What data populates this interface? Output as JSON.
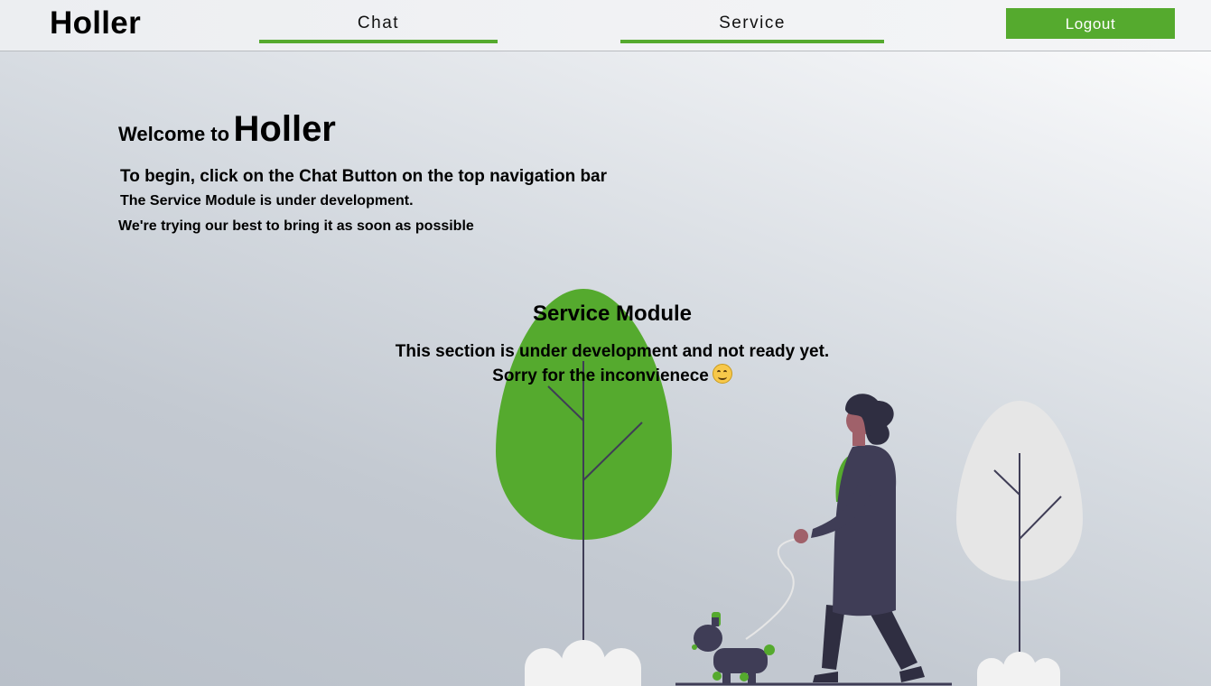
{
  "nav": {
    "brand": "Holler",
    "tabs": [
      {
        "label": "Chat"
      },
      {
        "label": "Service"
      }
    ],
    "logout_label": "Logout"
  },
  "intro": {
    "welcome_prefix": "Welcome to",
    "welcome_brand": "Holler",
    "line1": "To begin, click on the Chat Button on the top navigation bar",
    "line2": "The Service Module is under development.",
    "line3": "We're trying our best to bring it as soon as possible"
  },
  "service": {
    "title": "Service Module",
    "message_line1": "This section is under development and not ready yet.",
    "message_line2": "Sorry for the inconvienece",
    "emoji": "smiling-face-icon"
  },
  "colors": {
    "accent": "#55aa2e",
    "tree_light": "#e6e6e6",
    "figure_dark": "#3f3d56"
  }
}
